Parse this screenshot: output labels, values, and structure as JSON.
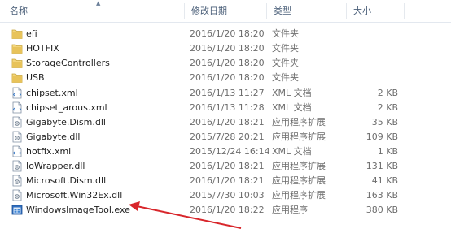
{
  "columns": {
    "name": "名称",
    "date": "修改日期",
    "type": "类型",
    "size": "大小"
  },
  "files": [
    {
      "icon": "folder-icon",
      "name": "efi",
      "date": "2016/1/20 18:20",
      "type": "文件夹",
      "size": ""
    },
    {
      "icon": "folder-icon",
      "name": "HOTFIX",
      "date": "2016/1/20 18:20",
      "type": "文件夹",
      "size": ""
    },
    {
      "icon": "folder-icon",
      "name": "StorageControllers",
      "date": "2016/1/20 18:20",
      "type": "文件夹",
      "size": ""
    },
    {
      "icon": "folder-icon",
      "name": "USB",
      "date": "2016/1/20 18:20",
      "type": "文件夹",
      "size": ""
    },
    {
      "icon": "xml-file-icon",
      "name": "chipset.xml",
      "date": "2016/1/13 11:27",
      "type": "XML 文档",
      "size": "2 KB"
    },
    {
      "icon": "xml-file-icon",
      "name": "chipset_arous.xml",
      "date": "2016/1/13 11:28",
      "type": "XML 文档",
      "size": "2 KB"
    },
    {
      "icon": "dll-file-icon",
      "name": "Gigabyte.Dism.dll",
      "date": "2016/1/20 18:21",
      "type": "应用程序扩展",
      "size": "35 KB"
    },
    {
      "icon": "dll-file-icon",
      "name": "Gigabyte.dll",
      "date": "2015/7/28 20:21",
      "type": "应用程序扩展",
      "size": "109 KB"
    },
    {
      "icon": "xml-file-icon",
      "name": "hotfix.xml",
      "date": "2015/12/24 16:14",
      "type": "XML 文档",
      "size": "1 KB"
    },
    {
      "icon": "dll-file-icon",
      "name": "IoWrapper.dll",
      "date": "2016/1/20 18:21",
      "type": "应用程序扩展",
      "size": "131 KB"
    },
    {
      "icon": "dll-file-icon",
      "name": "Microsoft.Dism.dll",
      "date": "2016/1/20 18:21",
      "type": "应用程序扩展",
      "size": "41 KB"
    },
    {
      "icon": "dll-file-icon",
      "name": "Microsoft.Win32Ex.dll",
      "date": "2015/7/30 10:03",
      "type": "应用程序扩展",
      "size": "163 KB"
    },
    {
      "icon": "exe-file-icon",
      "name": "WindowsImageTool.exe",
      "date": "2016/1/20 18:22",
      "type": "应用程序",
      "size": "380 KB"
    }
  ],
  "colors": {
    "arrow": "#d8262b",
    "folder": "#e8c35a",
    "header_text": "#4c607a"
  }
}
